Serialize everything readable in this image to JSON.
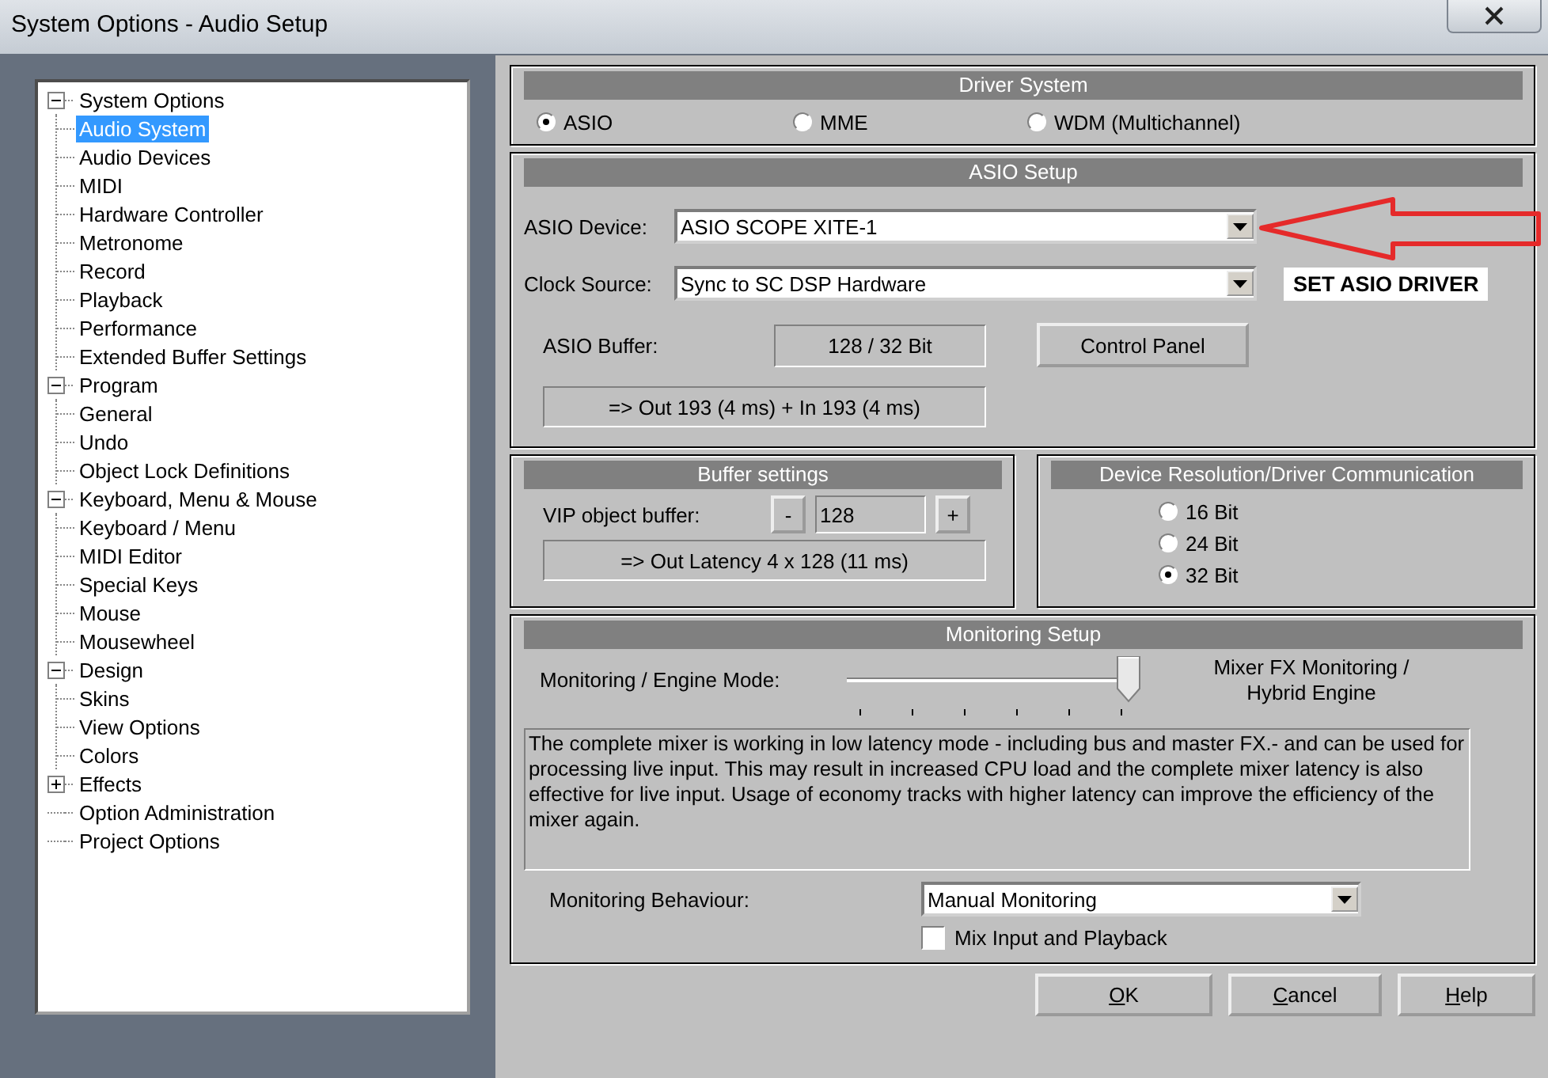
{
  "window": {
    "title": "System Options - Audio Setup"
  },
  "tree": [
    {
      "label": "System Options",
      "expanded": true,
      "selected": false,
      "children": [
        {
          "label": "Audio System",
          "selected": true
        },
        {
          "label": "Audio Devices",
          "selected": false
        },
        {
          "label": "MIDI",
          "selected": false
        },
        {
          "label": "Hardware Controller",
          "selected": false
        },
        {
          "label": "Metronome",
          "selected": false
        },
        {
          "label": "Record",
          "selected": false
        },
        {
          "label": "Playback",
          "selected": false
        },
        {
          "label": "Performance",
          "selected": false
        },
        {
          "label": "Extended Buffer Settings",
          "selected": false
        }
      ]
    },
    {
      "label": "Program",
      "expanded": true,
      "selected": false,
      "children": [
        {
          "label": "General",
          "selected": false
        },
        {
          "label": "Undo",
          "selected": false
        },
        {
          "label": "Object Lock Definitions",
          "selected": false
        }
      ]
    },
    {
      "label": "Keyboard, Menu & Mouse",
      "expanded": true,
      "selected": false,
      "children": [
        {
          "label": "Keyboard / Menu",
          "selected": false
        },
        {
          "label": "MIDI Editor",
          "selected": false
        },
        {
          "label": "Special Keys",
          "selected": false
        },
        {
          "label": "Mouse",
          "selected": false
        },
        {
          "label": "Mousewheel",
          "selected": false
        }
      ]
    },
    {
      "label": "Design",
      "expanded": true,
      "selected": false,
      "children": [
        {
          "label": "Skins",
          "selected": false
        },
        {
          "label": "View Options",
          "selected": false
        },
        {
          "label": "Colors",
          "selected": false
        }
      ]
    },
    {
      "label": "Effects",
      "expanded": false,
      "selected": false
    },
    {
      "label": "Option Administration",
      "selected": false
    },
    {
      "label": "Project Options",
      "selected": false
    }
  ],
  "driver_system": {
    "title": "Driver System",
    "options": [
      {
        "label": "ASIO",
        "selected": true
      },
      {
        "label": "MME",
        "selected": false
      },
      {
        "label": "WDM (Multichannel)",
        "selected": false
      }
    ]
  },
  "asio_setup": {
    "title": "ASIO Setup",
    "device_label": "ASIO Device:",
    "device_value": "ASIO SCOPE XITE-1",
    "clock_label": "Clock Source:",
    "clock_value": "Sync to SC DSP Hardware",
    "buffer_label": "ASIO Buffer:",
    "buffer_value": "128 / 32 Bit",
    "control_panel": "Control Panel",
    "latency": "=> Out 193 (4 ms) + In 193 (4 ms)"
  },
  "annotation": {
    "text": "SET ASIO DRIVER"
  },
  "buffer_settings": {
    "title": "Buffer settings",
    "label": "VIP object buffer:",
    "decrement": "-",
    "value": "128",
    "increment": "+",
    "latency": "=> Out Latency 4 x 128 (11 ms)"
  },
  "resolution": {
    "title": "Device Resolution/Driver Communication",
    "options": [
      {
        "label": "16 Bit",
        "selected": false
      },
      {
        "label": "24 Bit",
        "selected": false
      },
      {
        "label": "32 Bit",
        "selected": true
      }
    ]
  },
  "monitoring": {
    "title": "Monitoring Setup",
    "mode_label": "Monitoring / Engine Mode:",
    "mode": {
      "level": 1
    },
    "mode_value": "Mixer FX Monitoring / Hybrid Engine",
    "description": "The complete mixer is working in low latency mode - including bus and master FX.- and can be used for processing live input.  This may result in increased CPU load and the complete mixer latency is also effective for live input. Usage of economy tracks with higher latency can improve the efficiency of the mixer again.",
    "behaviour_label": "Monitoring Behaviour:",
    "behaviour_value": "Manual Monitoring",
    "mix_input": {
      "label": "Mix Input and Playback",
      "checked": false
    }
  },
  "buttons": [
    "OK",
    "Cancel",
    "Help"
  ]
}
